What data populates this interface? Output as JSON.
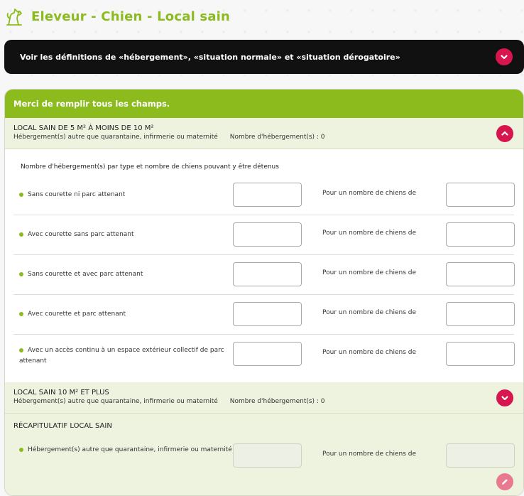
{
  "header": {
    "title": "Eleveur - Chien - Local sain",
    "title_icon": "dog-icon"
  },
  "definitions_bar": {
    "text": "Voir les définitions de «hébergement», «situation normale» et «situation dérogatoire»",
    "toggle_icon": "chevron-down-icon"
  },
  "card": {
    "header": "Merci de remplir tous les champs.",
    "sections": [
      {
        "title": "LOCAL SAIN DE 5 M² À MOINS DE 10 M²",
        "subtitle": "Hébergement(s) autre que quarantaine, infirmerie ou maternité",
        "count": "Nombre d'hébergement(s) : 0",
        "toggle_icon": "chevron-up-icon"
      },
      {
        "title": "LOCAL SAIN 10 M² ET PLUS",
        "subtitle": "Hébergement(s) autre que quarantaine, infirmerie ou maternité",
        "count": "Nombre d'hébergement(s) : 0",
        "toggle_icon": "chevron-down-icon"
      }
    ],
    "form": {
      "intro": "Nombre d'hébergement(s) par type et nombre de chiens pouvant y être détenus",
      "right_label": "Pour un nombre de chiens de",
      "rows": [
        {
          "label": "Sans courette ni parc attenant",
          "count_value": "",
          "dogs_value": ""
        },
        {
          "label": "Avec courette sans parc attenant",
          "count_value": "",
          "dogs_value": ""
        },
        {
          "label": "Sans courette et avec parc attenant",
          "count_value": "",
          "dogs_value": ""
        },
        {
          "label": "Avec courette et parc attenant",
          "count_value": "",
          "dogs_value": ""
        },
        {
          "label": "Avec un accès continu à un espace extérieur collectif de parc attenant",
          "count_value": "",
          "dogs_value": ""
        }
      ]
    },
    "recap": {
      "title": "RÉCAPITULATIF LOCAL SAIN",
      "row_label": "Hébergement(s) autre que quarantaine, infirmerie ou maternité",
      "right_label": "Pour un nombre de chiens de",
      "edit_icon": "pencil-icon"
    }
  },
  "colors": {
    "accent_green": "#8cbb1e",
    "accent_pink": "#d7164f",
    "dark_bar": "#111111",
    "section_bg": "#eef3e0"
  }
}
